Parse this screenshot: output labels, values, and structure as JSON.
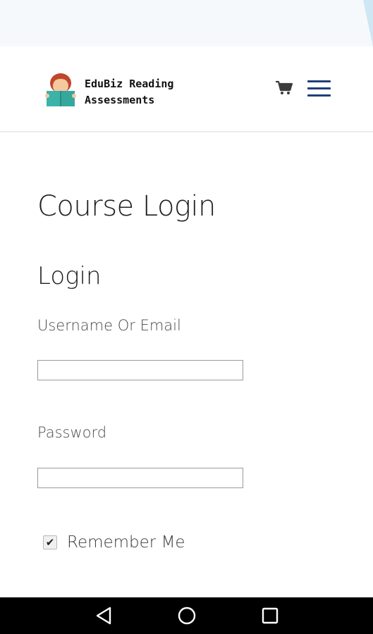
{
  "header": {
    "brand_line1": "EduBiz Reading",
    "brand_line2": "Assessments",
    "logo_icon": "reading-child-logo",
    "cart_icon": "cart-icon",
    "menu_icon": "hamburger-menu-icon",
    "menu_color": "#1e3f7a"
  },
  "main": {
    "page_title": "Course Login",
    "form_heading": "Login",
    "username_label": "Username Or Email",
    "username_value": "",
    "password_label": "Password",
    "password_value": "",
    "remember_label": "Remember Me",
    "remember_checked": true
  },
  "system_nav": {
    "back_icon": "back-triangle-icon",
    "home_icon": "home-circle-icon",
    "recent_icon": "recent-apps-square-icon"
  }
}
